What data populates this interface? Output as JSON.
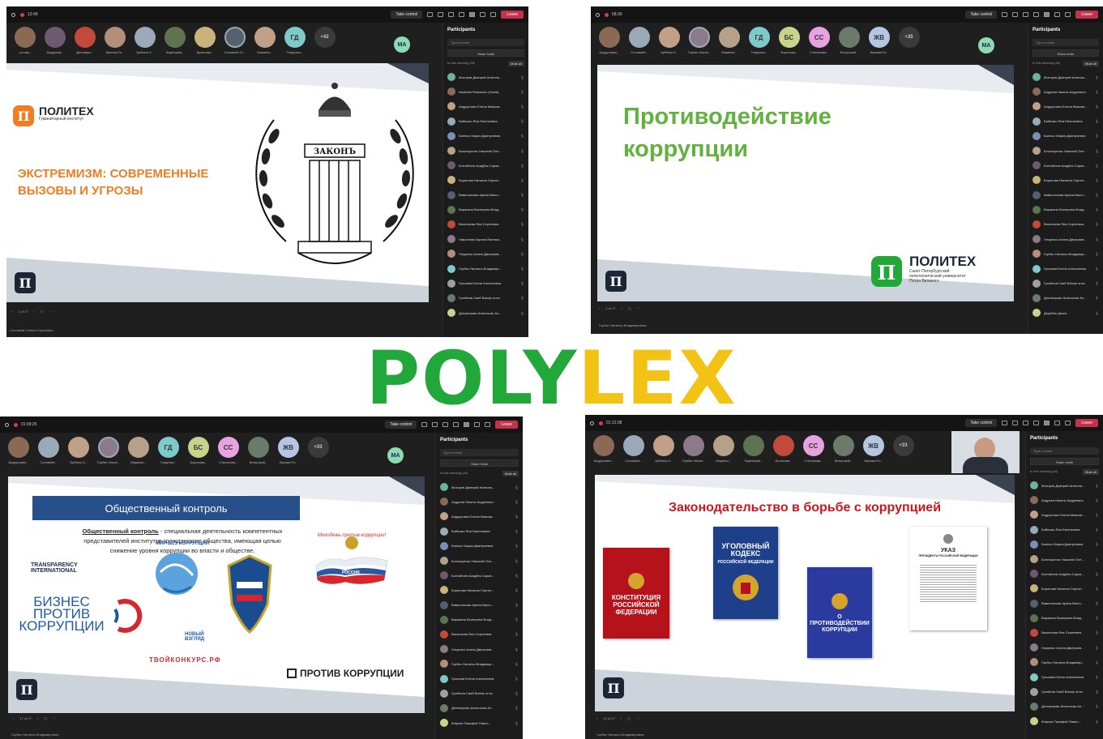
{
  "banner": {
    "part1": "POLY",
    "part2": "LEX"
  },
  "colors": {
    "teams_bg": "#1f1f1f",
    "leave_red": "#c4314b",
    "polylex_green": "#22a83a",
    "polylex_yellow": "#f2c214",
    "politex_orange": "#ef7d22",
    "slide_green": "#63b23f"
  },
  "q1": {
    "timer": "13:49",
    "take_control": "Take control",
    "leave": "Leave",
    "participants": {
      "title": "Participants",
      "search_placeholder": "Type a name",
      "share_invite": "Share invite",
      "in_meeting": "In this meeting (33)",
      "mute_all": "Mute all",
      "list": [
        "Мохоров Дмитрий Анатоль...",
        "Nodirbek Rustamov (Guest)",
        "Андрухович Елена Максим...",
        "Бабешко Яна Евгеньевна",
        "Банных Мария Дмитриевна",
        "Богатыренко Николай Оле...",
        "Болтабоев Асадбек Саров...",
        "Борисова Наталия Сергее...",
        "Вавилонская Арина Викто...",
        "Варакина Екатерина Влад...",
        "Васильева Яна Сергеевна",
        "Гаврилова Карина Евгенье...",
        "Гнеденко Алина Дмитриев...",
        "Горбач Наталья Владимир...",
        "Грошева Елена Алексеевна",
        "Гусейнов Саиб Вагиф оглы",
        "Деловерова Анастасия Ал..."
      ],
      "organizer_note": "Organizer",
      "guest_note": "Meeting guest"
    },
    "strip_names": [
      "..остова ..",
      "Андрухов..",
      "Деловеро..",
      "Капина Ел..",
      "Зубенко К..",
      "Юденцева..",
      "Бухалова..",
      "Соловьёв Ст..",
      "Маранко..",
      "Гнеденко.."
    ],
    "strip_more": "+42",
    "initials_right": "МА",
    "strip_initials": [
      "ГД"
    ],
    "slide": {
      "logo_name": "ПОЛИТЕХ",
      "logo_sub": "Гуманитарный институт",
      "title": "ЭКСТРЕМИЗМ: СОВРЕМЕННЫЕ ВЫЗОВЫ И УГРОЗЫ",
      "emblem_text": "ЗАКОНЪ",
      "pi": "П"
    },
    "page": "1 of 17",
    "presenter": "Соловьёв Степан Сергеевич"
  },
  "q2": {
    "timer": "58:30",
    "take_control": "Take control",
    "leave": "Leave",
    "participants": {
      "title": "Participants",
      "search_placeholder": "Type a name",
      "share_invite": "Share invite",
      "in_meeting": "In this meeting (46)",
      "mute_all": "Mute all",
      "list": [
        "Мохоров Дмитрий Анатоль...",
        "Андреев Никита Андреевич",
        "Андрухович Елена Максим...",
        "Бабешко Яна Евгеньевна",
        "Банных Мария Дмитриевна",
        "Богатыренко Николай Оле...",
        "Болтабоев Асадбек Саров...",
        "Борисова Наталия Сергее...",
        "Вавилонская Арина Викто...",
        "Варакина Екатерина Влад...",
        "Васильева Яна Сергеевна",
        "Гнеденко Алина Дмитриев...",
        "Горбач Наталья Владимир...",
        "Грошева Елена Алексеевна",
        "Гусейнов Саиб Вагиф оглы",
        "Деловерова Анастасия Ал...",
        "Дерябин Денис"
      ],
      "organizer_note": "Organizer"
    },
    "strip_names": [
      "Андрухович..",
      "Соловьёв..",
      "Зубенко К..",
      "Горбач Натал..",
      "Маранко..",
      "Гнеденко..",
      "Борисова..",
      "Степанова..",
      "Венгрский..",
      "Жукова Ел.."
    ],
    "strip_initials": [
      "ГД",
      "БС",
      "СС",
      "ЖВ"
    ],
    "strip_more": "+35",
    "initials_right": "МА",
    "slide": {
      "title": "Противодействие коррупции",
      "logo_name": "ПОЛИТЕХ",
      "logo_sub1": "Санкт-Петербургский",
      "logo_sub2": "политехнический университет",
      "logo_sub3": "Петра Великого",
      "pi": "П"
    },
    "page": "1 of 17",
    "presenter": "Горбач Наталья Владимировна"
  },
  "q3": {
    "timer": "01:09:25",
    "take_control": "Take control",
    "leave": "Leave",
    "participants": {
      "title": "Participants",
      "search_placeholder": "Type a name",
      "share_invite": "Share invite",
      "in_meeting": "In this meeting (44)",
      "mute_all": "Mute all",
      "list": [
        "Мохоров Дмитрий Анатоль...",
        "Андреев Никита Андреевич",
        "Андрухович Елена Максим...",
        "Бабешко Яна Евгеньевна",
        "Банных Мария Дмитриевна",
        "Богатыренко Николай Оле...",
        "Болтабоев Асадбек Саров...",
        "Борисова Наталия Сергее...",
        "Вавилонская Арина Викто...",
        "Варакина Екатерина Влад...",
        "Васильева Яна Сергеевна",
        "Гнеденко Алина Дмитриев...",
        "Горбач Наталья Владимир...",
        "Грошева Елена Алексеевна",
        "Гусейнов Саиб Вагиф оглы",
        "Деловерова Анастасия Ал...",
        "Жарков Тимофей Павло..."
      ],
      "organizer_note": "Organizer"
    },
    "strip_names": [
      "Андрухович..",
      "Соловьёв..",
      "Зубенко К..",
      "Горбач Натал..",
      "Маранко..",
      "Гнеденко..",
      "Борисова..",
      "Степанова..",
      "Венгрский..",
      "Жукова Ел.."
    ],
    "strip_initials": [
      "ГД",
      "БС",
      "СС",
      "ЖВ"
    ],
    "strip_more": "+33",
    "initials_right": "МА",
    "slide": {
      "title": "Общественный контроль",
      "def_term": "Общественный контроль",
      "def_rest": " - специальная деятельность компетентных представителей институтов гражданского общества, имеющая целью снижение уровня коррупции во власти и обществе.",
      "ti": "TRANSPARENCY INTERNATIONAL",
      "biz1": "БИЗНЕС",
      "biz2": "ПРОТИВ",
      "biz3": "КОРРУПЦИИ",
      "mir": "МИР БЕЗ КОРРУПЦИИ",
      "contest": "ТВОЙКОНКУРС.РФ",
      "novy": "НОВЫЙ ВЗГЛЯД",
      "molodezh": "Молодежь против коррупции!",
      "rossiya": "РОССИЯ",
      "protiv": "ПРОТИВ КОРРУПЦИИ",
      "pi": "П"
    },
    "page": "17 of 17",
    "presenter": "Горбач Наталья Владимировна"
  },
  "q4": {
    "timer": "01:12:38",
    "take_control": "Take control",
    "leave": "Leave",
    "participants": {
      "title": "Participants",
      "search_placeholder": "Type a name",
      "share_invite": "Share invite",
      "in_meeting": "In this meeting (44)",
      "mute_all": "Mute all",
      "list": [
        "Мохоров Дмитрий Анатоль...",
        "Андреев Никита Андреевич",
        "Андрухович Елена Максим...",
        "Бабешко Яна Евгеньевна",
        "Банных Мария Дмитриевна",
        "Богатыренко Николай Оле...",
        "Болтабоев Асадбек Саров...",
        "Борисова Наталия Сергее...",
        "Вавилонская Арина Викто...",
        "Варакина Екатерина Влад...",
        "Васильева Яна Сергеевна",
        "Гнеденко Алина Дмитриев...",
        "Горбач Наталья Владимир...",
        "Грошева Елена Алексеевна",
        "Гусейнов Саиб Вагиф оглы",
        "Деловерова Анастасия Ал...",
        "Жарков Тимофей Павло..."
      ],
      "organizer_note": "Organizer"
    },
    "strip_names": [
      "Андрухович..",
      "Соловьёв..",
      "Зубенко К..",
      "Горбач Натал..",
      "Маранко..",
      "Юденцева..",
      "Болотова..",
      "Степанова..",
      "Венгрский..",
      "Жукова Ел.."
    ],
    "strip_initials": [
      "СС",
      "ЖВ"
    ],
    "strip_more": "+33",
    "slide": {
      "title": "Законодательство в борьбе с коррупцией",
      "book1": "КОНСТИТУЦИЯ РОССИЙСКОЙ ФЕДЕРАЦИИ",
      "book2a": "УГОЛОВНЫЙ КОДЕКС",
      "book2b": "РОССИЙСКОЙ ФЕДЕРАЦИИ",
      "book3": "О ПРОТИВОДЕЙСТВИИ КОРРУПЦИИ",
      "doc1": "УКАЗ",
      "doc2": "ПРЕЗИДЕНТА РОССИЙСКОЙ ФЕДЕРАЦИИ",
      "pi": "П"
    },
    "page": "14 of 17",
    "presenter": "Горбач Наталья Владимировна"
  }
}
